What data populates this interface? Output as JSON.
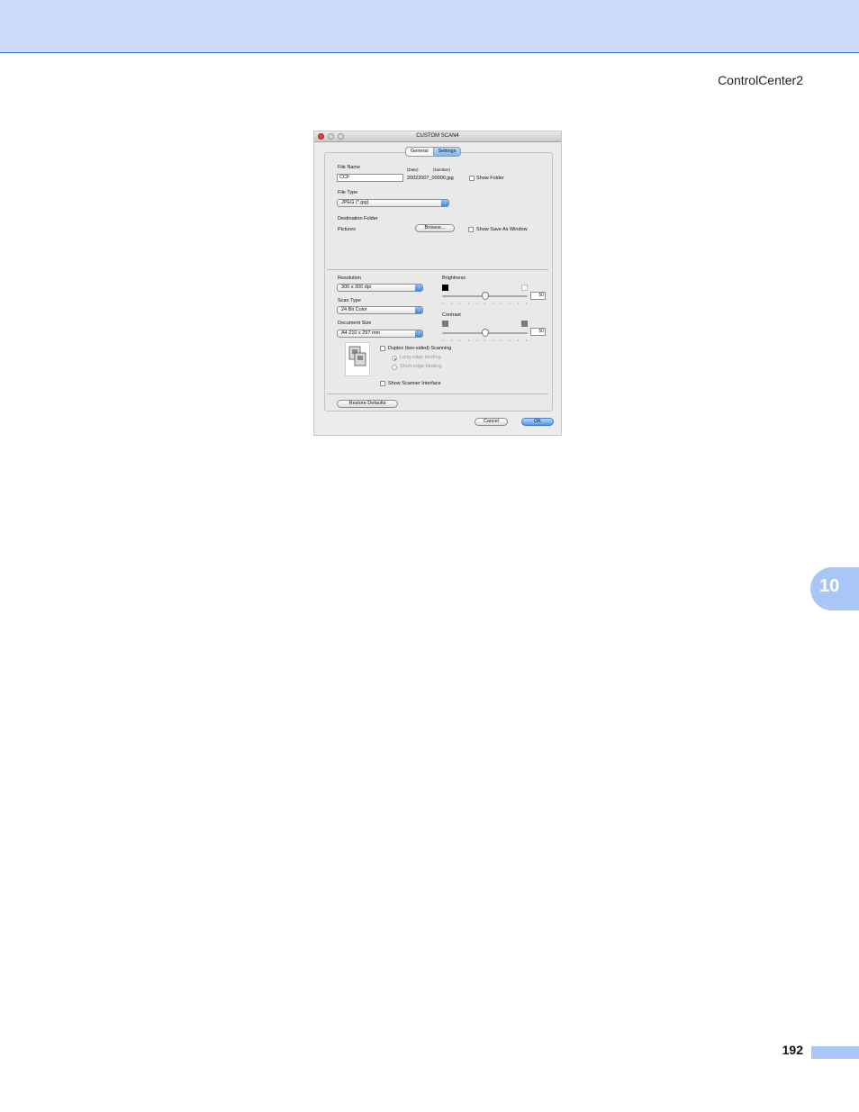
{
  "page": {
    "header_title": "ControlCenter2",
    "chapter_number": "10",
    "page_number": "192"
  },
  "dialog": {
    "title": "CUSTOM SCAN4",
    "tabs": [
      {
        "label": "General",
        "active": false
      },
      {
        "label": "Settings",
        "active": true
      }
    ],
    "file_name": {
      "label": "File Name",
      "value": "CCF",
      "date_label": "(Date)",
      "number_label": "(Number)",
      "preview": "20022007_00000.jpg",
      "show_folder_label": "Show Folder",
      "show_folder_checked": false
    },
    "file_type": {
      "label": "File Type",
      "value": "JPEG (*.jpg)"
    },
    "destination": {
      "label": "Destination Folder",
      "folder": "Pictures",
      "browse_label": "Browse...",
      "show_save_as_label": "Show Save As Window",
      "show_save_as_checked": false
    },
    "resolution": {
      "label": "Resolution",
      "value": "300 x 300 dpi"
    },
    "scan_type": {
      "label": "Scan Type",
      "value": "24 Bit Color"
    },
    "document_size": {
      "label": "Document Size",
      "value": "A4  210 x 297 mm"
    },
    "brightness": {
      "label": "Brightness",
      "value": "50",
      "min": 0,
      "max": 100
    },
    "contrast": {
      "label": "Contrast",
      "value": "50",
      "min": 0,
      "max": 100
    },
    "duplex": {
      "label": "Duplex (two-sided) Scanning",
      "checked": false,
      "long_edge_label": "Long-edge binding",
      "short_edge_label": "Short-edge binding",
      "selected": "long-edge"
    },
    "show_scanner_interface": {
      "label": "Show Scanner Interface",
      "checked": false
    },
    "restore_defaults_label": "Restore Defaults",
    "cancel_label": "Cancel",
    "ok_label": "OK",
    "colors": {
      "accent_blue": "#4f97ec",
      "close_red": "#e04436",
      "brightness_dark": "#000000",
      "brightness_light": "#ffffff",
      "contrast_low": "#7a7a7a",
      "contrast_high": "#7a7a7a"
    }
  },
  "colors": {
    "header_band": "#ccdcfb",
    "chapter_tab": "#aac6f7",
    "page_bar": "#aac6f7"
  }
}
